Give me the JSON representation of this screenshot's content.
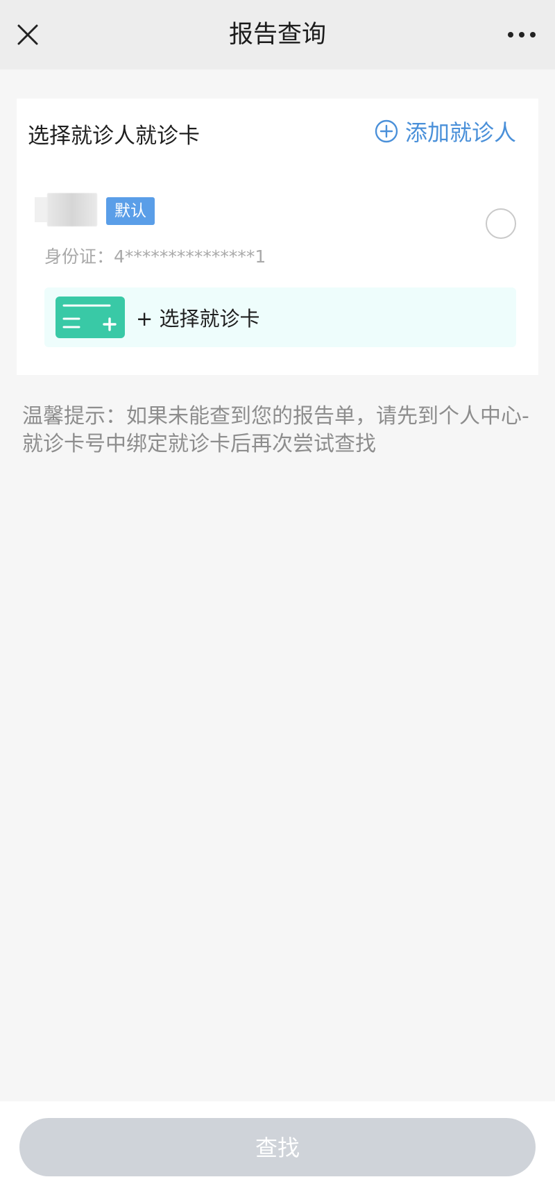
{
  "nav": {
    "title": "报告查询",
    "close_icon": "close-icon",
    "more_icon": "more-icon"
  },
  "card": {
    "title": "选择就诊人就诊卡",
    "add_patient_label": "添加就诊人",
    "add_icon": "plus-circle-icon",
    "patient": {
      "badge": "默认",
      "id_line": "身份证：4***************1"
    },
    "select_card_label": "+ 选择就诊卡"
  },
  "tip": "温馨提示：如果未能查到您的报告单，请先到个人中心-就诊卡号中绑定就诊卡后再次尝试查找",
  "bottom": {
    "search_label": "查找"
  },
  "colors": {
    "accent": "#4a90d9",
    "badge": "#5a9ee8",
    "card_icon": "#39c9a6",
    "button_disabled": "#cfd3d9",
    "background": "#f6f6f6"
  }
}
